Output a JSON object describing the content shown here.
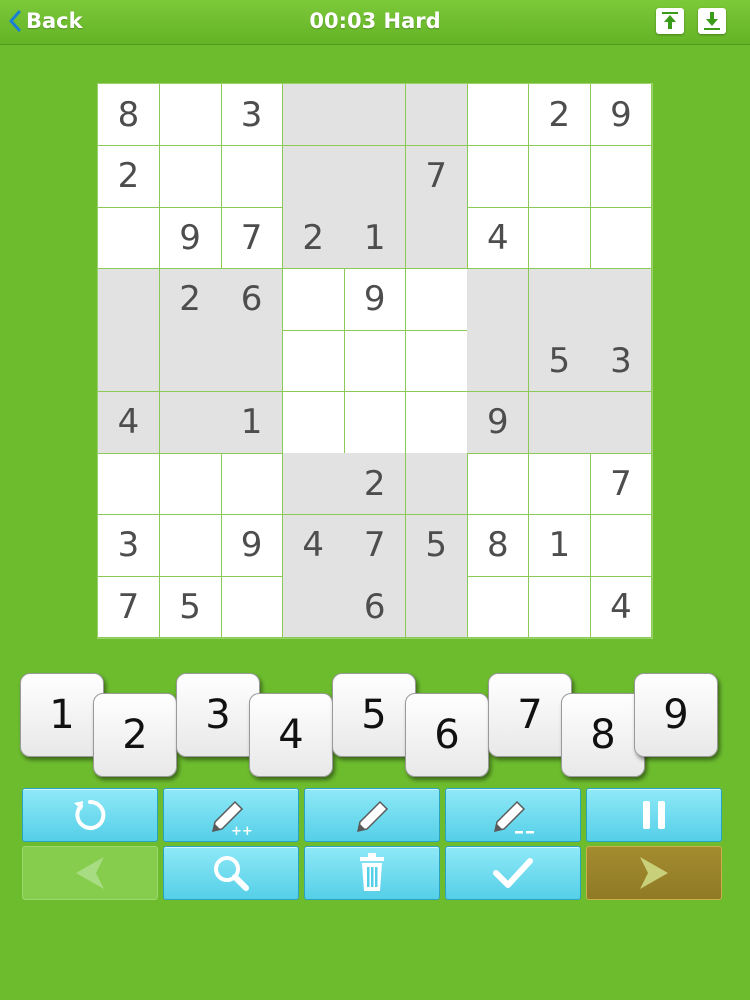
{
  "header": {
    "back_label": "Back",
    "timer": "00:03",
    "difficulty": "Hard",
    "title": "00:03 Hard"
  },
  "board": {
    "grid": [
      [
        8,
        0,
        3,
        0,
        0,
        0,
        0,
        2,
        9
      ],
      [
        2,
        0,
        0,
        0,
        0,
        7,
        0,
        0,
        0
      ],
      [
        0,
        9,
        7,
        2,
        1,
        0,
        4,
        0,
        0
      ],
      [
        0,
        2,
        6,
        0,
        9,
        0,
        0,
        0,
        0
      ],
      [
        0,
        0,
        0,
        0,
        0,
        0,
        0,
        5,
        3
      ],
      [
        4,
        0,
        1,
        0,
        0,
        0,
        9,
        0,
        0
      ],
      [
        0,
        0,
        0,
        0,
        2,
        0,
        0,
        0,
        7
      ],
      [
        3,
        0,
        9,
        4,
        7,
        5,
        8,
        1,
        0
      ],
      [
        7,
        5,
        0,
        0,
        6,
        0,
        0,
        0,
        4
      ]
    ]
  },
  "number_keys": [
    "1",
    "2",
    "3",
    "4",
    "5",
    "6",
    "7",
    "8",
    "9"
  ],
  "toolbar": {
    "row1": [
      "restart-icon",
      "pencil-plus-icon",
      "pencil-icon",
      "pencil-minus-icon",
      "pause-icon"
    ],
    "row2": [
      "arrow-left-icon",
      "magnifier-icon",
      "trash-icon",
      "checkmark-icon",
      "arrow-right-icon"
    ]
  },
  "colors": {
    "background": "#6dbc2e",
    "cell_shaded": "#e2e2e2",
    "cell_text": "#4d4d4d",
    "tool_button": "#6ad8ee",
    "next_button": "#9a8429"
  }
}
